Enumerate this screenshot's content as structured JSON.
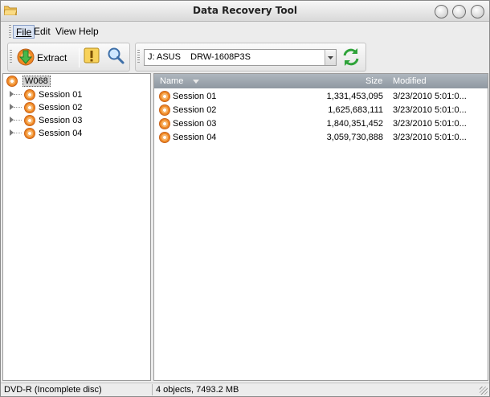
{
  "window": {
    "title": "Data Recovery Tool"
  },
  "menu": {
    "items": [
      "File",
      "Edit",
      "View",
      "Help"
    ]
  },
  "toolbar": {
    "extract_label": "Extract",
    "drive_value": "J: ASUS    DRW-1608P3S"
  },
  "tree": {
    "root_label": "W068",
    "items": [
      "Session 01",
      "Session 02",
      "Session 03",
      "Session 04"
    ]
  },
  "list": {
    "columns": {
      "name": "Name",
      "size": "Size",
      "modified": "Modified"
    },
    "rows": [
      {
        "name": "Session 01",
        "size": "1,331,453,095",
        "modified": "3/23/2010 5:01:0..."
      },
      {
        "name": "Session 02",
        "size": "1,625,683,111",
        "modified": "3/23/2010 5:01:0..."
      },
      {
        "name": "Session 03",
        "size": "1,840,351,452",
        "modified": "3/23/2010 5:01:0..."
      },
      {
        "name": "Session 04",
        "size": "3,059,730,888",
        "modified": "3/23/2010 5:01:0..."
      }
    ]
  },
  "status": {
    "left": "DVD-R (Incomplete disc)",
    "right": "4 objects, 7493.2 MB"
  },
  "icons": {
    "app": "folder-icon",
    "extract": "extract-disc-icon",
    "info": "info-icon",
    "search": "magnifier-icon",
    "refresh": "refresh-icon",
    "disc": "disc-icon"
  },
  "colors": {
    "header": "#9aa2ab",
    "disc_orange": "#f08a25",
    "refresh_green": "#2fa33a"
  }
}
